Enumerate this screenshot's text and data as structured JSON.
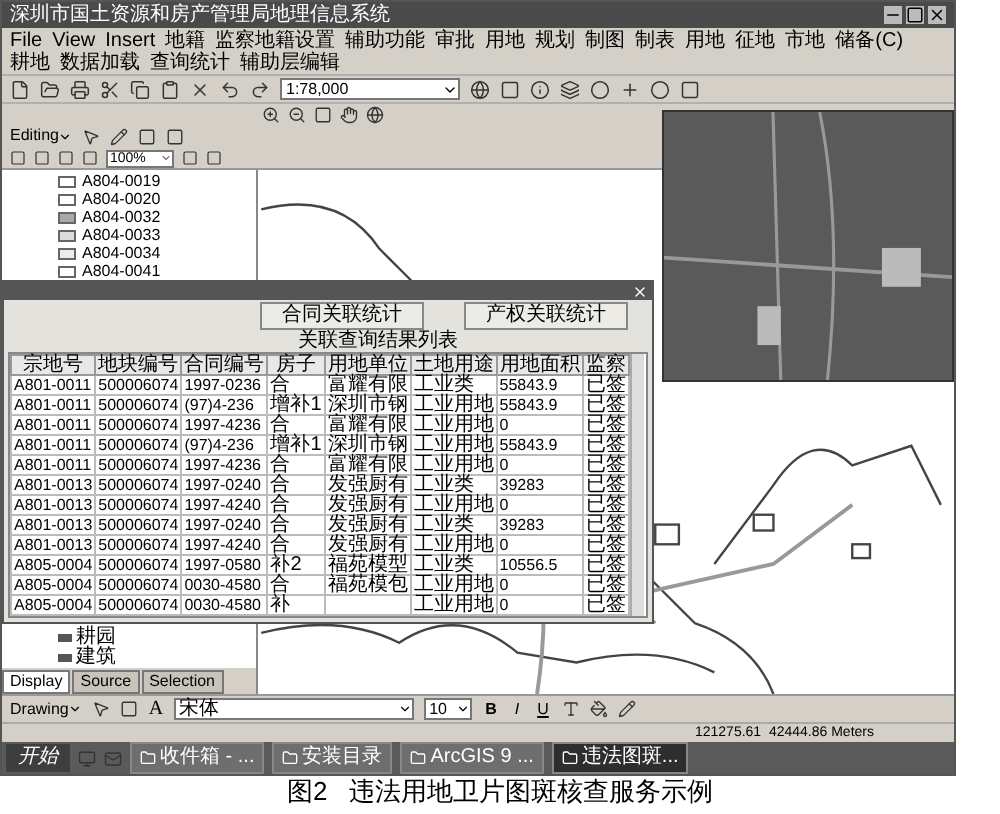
{
  "window": {
    "title": "深圳市国土资源和房产管理局地理信息系统"
  },
  "menu": [
    "File",
    "View",
    "Insert",
    "地籍",
    "监察地籍设置",
    "辅助功能",
    "审批",
    "用地",
    "规划",
    "制图",
    "制表",
    "用地",
    "征地",
    "市地",
    "储备(C)",
    "耕地",
    "数据加载",
    "查询统计",
    "辅助层编辑"
  ],
  "toolbar": {
    "scale": "1:78,000"
  },
  "editor": {
    "label": "Editing"
  },
  "layer_toolbar": {
    "zoom": "100%"
  },
  "toc": {
    "items": [
      {
        "label": "A804-0019",
        "color": "#ffffff"
      },
      {
        "label": "A804-0020",
        "color": "#ffffff"
      },
      {
        "label": "A804-0032",
        "color": "#a8a8a8"
      },
      {
        "label": "A804-0033",
        "color": "#dcdcdc"
      },
      {
        "label": "A804-0034",
        "color": "#ececec"
      },
      {
        "label": "A804-0041",
        "color": "#ffffff"
      }
    ],
    "legend": [
      "耕园",
      "建筑"
    ],
    "tabs": [
      {
        "label": "Display",
        "selected": true
      },
      {
        "label": "Source",
        "selected": false
      },
      {
        "label": "Selection",
        "selected": false
      }
    ]
  },
  "dialog": {
    "buttons": [
      "合同关联统计",
      "产权关联统计"
    ],
    "list_title": "关联查询结果列表",
    "columns": [
      {
        "label": "宗地号",
        "kind": "code"
      },
      {
        "label": "地块编号",
        "kind": "code"
      },
      {
        "label": "合同编号",
        "kind": "code"
      },
      {
        "label": "房子",
        "kind": "text"
      },
      {
        "label": "用地单位",
        "kind": "text"
      },
      {
        "label": "土地用途",
        "kind": "text"
      },
      {
        "label": "用地面积",
        "kind": "code"
      },
      {
        "label": "监察",
        "kind": "text"
      }
    ],
    "rows": [
      [
        "A801-0011",
        "500006074",
        "1997-0236",
        "合",
        "富耀有限",
        "工业类",
        "55843.9",
        "已签"
      ],
      [
        "A801-0011",
        "500006074",
        "(97)4-236",
        "增补1",
        "深圳市钢",
        "工业用地",
        "55843.9",
        "已签"
      ],
      [
        "A801-0011",
        "500006074",
        "1997-4236",
        "合",
        "富耀有限",
        "工业用地",
        "0",
        "已签"
      ],
      [
        "A801-0011",
        "500006074",
        "(97)4-236",
        "增补1",
        "深圳市钢",
        "工业用地",
        "55843.9",
        "已签"
      ],
      [
        "A801-0011",
        "500006074",
        "1997-4236",
        "合",
        "富耀有限",
        "工业用地",
        "0",
        "已签"
      ],
      [
        "A801-0013",
        "500006074",
        "1997-0240",
        "合",
        "发强厨有",
        "工业类",
        "39283",
        "已签"
      ],
      [
        "A801-0013",
        "500006074",
        "1997-4240",
        "合",
        "发强厨有",
        "工业用地",
        "0",
        "已签"
      ],
      [
        "A801-0013",
        "500006074",
        "1997-0240",
        "合",
        "发强厨有",
        "工业类",
        "39283",
        "已签"
      ],
      [
        "A801-0013",
        "500006074",
        "1997-4240",
        "合",
        "发强厨有",
        "工业用地",
        "0",
        "已签"
      ],
      [
        "A805-0004",
        "500006074",
        "1997-0580",
        "补2",
        "福苑模型",
        "工业类",
        "10556.5",
        "已签"
      ],
      [
        "A805-0004",
        "500006074",
        "0030-4580",
        "合",
        "福苑模包",
        "工业用地",
        "0",
        "已签"
      ],
      [
        "A805-0004",
        "500006074",
        "0030-4580",
        "补",
        null,
        "工业用地",
        "0",
        "已签"
      ]
    ]
  },
  "drawing_toolbar": {
    "label": "Drawing",
    "font": "宋体",
    "size": "10",
    "format_buttons": [
      "B",
      "I",
      "U"
    ],
    "text_color": "A"
  },
  "status_bar": {
    "coordinates": "121275.61  42444.86 Meters"
  },
  "taskbar": {
    "start": "开始",
    "tasks": [
      {
        "label": "收件箱 - ...",
        "selected": false
      },
      {
        "label": "安装目录",
        "selected": false
      },
      {
        "label": "ArcGIS 9 ...",
        "selected": false
      },
      {
        "label": "违法图斑...",
        "selected": true
      }
    ]
  },
  "figure": {
    "number": "图2",
    "title": "违法用地卫片图斑核查服务示例"
  }
}
